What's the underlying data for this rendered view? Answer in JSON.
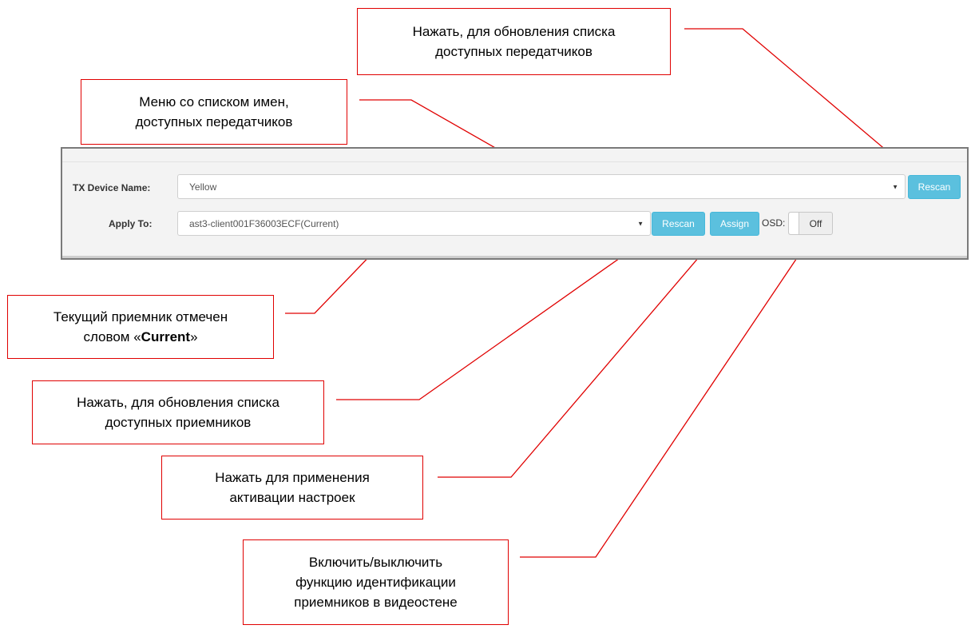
{
  "form": {
    "tx_device_label": "TX Device Name:",
    "tx_device_value": "Yellow",
    "tx_rescan_label": "Rescan",
    "apply_to_label": "Apply To:",
    "apply_to_value": "ast3-client001F36003ECF(Current)",
    "rx_rescan_label": "Rescan",
    "assign_label": "Assign",
    "osd_label": "OSD:",
    "osd_state": "Off"
  },
  "callouts": {
    "tx_rescan": [
      "Нажать, для обновления списка",
      "доступных передатчиков"
    ],
    "tx_menu": [
      "Меню со списком имен,",
      "доступных передатчиков"
    ],
    "current_rx": {
      "line1": "Текущий приемник отмечен",
      "line2_prefix": "словом «",
      "line2_bold": "Current",
      "line2_suffix": "»"
    },
    "rx_rescan": [
      "Нажать, для обновления списка",
      "доступных приемников"
    ],
    "assign": [
      "Нажать для применения",
      "активации настроек"
    ],
    "osd": [
      "Включить/выключить",
      "функцию идентификации",
      "приемников в видеостене"
    ]
  },
  "colors": {
    "annotation_red": "#e00000",
    "button_info": "#5bc0de"
  }
}
